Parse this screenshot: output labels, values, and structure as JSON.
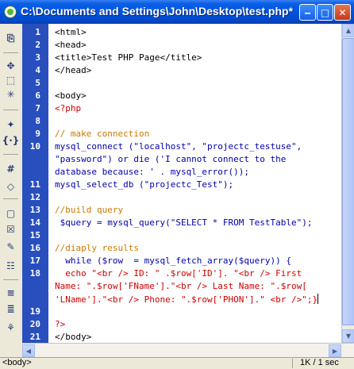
{
  "window": {
    "title": "C:\\Documents and Settings\\John\\Desktop\\test.php*",
    "min_glyph": "‒",
    "max_glyph": "□",
    "close_glyph": "✕"
  },
  "toolbar_icons": [
    {
      "name": "new-document-icon",
      "glyph": "⎘"
    },
    {
      "name": "expand-icon",
      "glyph": "✥"
    },
    {
      "name": "select-block-icon",
      "glyph": "⬚"
    },
    {
      "name": "collapse-icon",
      "glyph": "✳"
    },
    {
      "name": "code-hint-icon",
      "glyph": "✦"
    },
    {
      "name": "braces-icon",
      "glyph": "{·}"
    },
    {
      "name": "hash-icon",
      "glyph": "#"
    },
    {
      "name": "tag-icon",
      "glyph": "◇"
    },
    {
      "name": "comment-icon",
      "glyph": "▢"
    },
    {
      "name": "remove-comment-icon",
      "glyph": "☒"
    },
    {
      "name": "wrap-tag-icon",
      "glyph": "✎"
    },
    {
      "name": "snippets-icon",
      "glyph": "☷"
    },
    {
      "name": "indent-icon",
      "glyph": "≡"
    },
    {
      "name": "outdent-icon",
      "glyph": "≣"
    },
    {
      "name": "format-icon",
      "glyph": "⚘"
    }
  ],
  "line_numbers": [
    "1",
    "2",
    "3",
    "4",
    "5",
    "6",
    "7",
    "8",
    "9",
    "10",
    "11",
    "12",
    "13",
    "14",
    "15",
    "16",
    "17",
    "18",
    "19",
    "20",
    "21"
  ],
  "code_lines": [
    {
      "t": "<html>",
      "c": "black"
    },
    {
      "t": "<head>",
      "c": "black"
    },
    {
      "t": "<title>Test PHP Page</title>",
      "c": "black"
    },
    {
      "t": "</head>",
      "c": "black"
    },
    {
      "t": "",
      "c": "black"
    },
    {
      "t": "<body>",
      "c": "black"
    },
    {
      "t": "<?php",
      "c": "red"
    },
    {
      "t": "",
      "c": "black"
    },
    {
      "t": "// make connection",
      "c": "orange"
    },
    {
      "t": "mysql_connect (\"localhost\", \"projectc_testuse\",",
      "c": "blue"
    },
    {
      "t": "\"password\") or die ('I cannot connect to the",
      "c": "blue"
    },
    {
      "t": "database because: ' . mysql_error());",
      "c": "blue"
    },
    {
      "t": "mysql_select_db (\"projectc_Test\");",
      "c": "blue"
    },
    {
      "t": "",
      "c": "black"
    },
    {
      "t": "//build query",
      "c": "orange"
    },
    {
      "t": " $query = mysql_query(\"SELECT * FROM TestTable\");",
      "c": "blue"
    },
    {
      "t": "",
      "c": "black"
    },
    {
      "t": "//diaply results",
      "c": "orange"
    },
    {
      "t": "  while ($row  = mysql_fetch_array($query)) {",
      "c": "blue"
    },
    {
      "t": "  echo \"<br /> ID: \" .$row['ID']. \"<br /> First",
      "c": "red"
    },
    {
      "t": "Name: \".$row['FName'].\"<br /> Last Name: \".$row[",
      "c": "red"
    },
    {
      "t": "'LName'].\"<br /> Phone: \".$row['PHON'].\" <br />\";}",
      "c": "red"
    },
    {
      "t": "",
      "c": "black"
    },
    {
      "t": "?>",
      "c": "red"
    },
    {
      "t": "</body>",
      "c": "black"
    }
  ],
  "statusbar": {
    "tag_selector": "<body>",
    "size": "1K / 1 sec"
  }
}
